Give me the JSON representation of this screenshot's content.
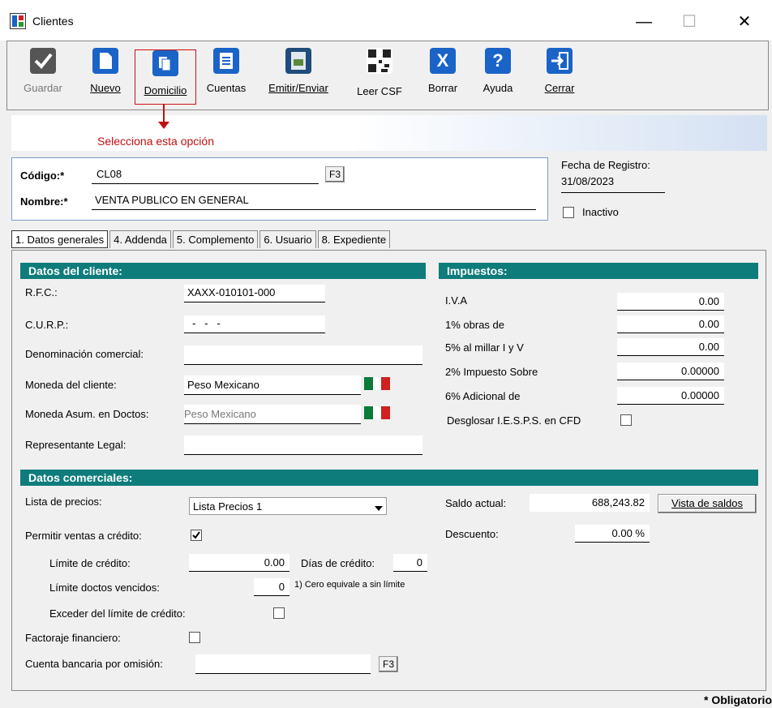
{
  "window": {
    "title": "Clientes",
    "minimize": "—",
    "maximize": "☐",
    "close": "✕"
  },
  "toolbar": {
    "items": [
      {
        "label": "Guardar",
        "icon": "checkmark-icon"
      },
      {
        "label": "Nuevo",
        "icon": "new-document-icon"
      },
      {
        "label": "Domicilio",
        "icon": "address-icon"
      },
      {
        "label": "Cuentas",
        "icon": "list-icon"
      },
      {
        "label": "Emitir/Enviar",
        "icon": "send-document-icon"
      },
      {
        "label": "Leer CSF",
        "icon": "qr-code-icon"
      },
      {
        "label": "Borrar",
        "icon": "delete-icon"
      },
      {
        "label": "Ayuda",
        "icon": "help-icon"
      },
      {
        "label": "Cerrar",
        "icon": "exit-icon"
      }
    ]
  },
  "annotation": "Selecciona esta opción",
  "header": {
    "codigo_label": "Código:*",
    "codigo_value": "CL08",
    "f3": "F3",
    "nombre_label": "Nombre:*",
    "nombre_value": "VENTA PUBLICO EN GENERAL",
    "fecha_label": "Fecha de Registro:",
    "fecha_value": "31/08/2023",
    "inactivo_label": "Inactivo"
  },
  "tabs": [
    "1. Datos generales",
    "4. Addenda",
    "5. Complemento",
    "6. Usuario",
    "8. Expediente"
  ],
  "datos_cliente": {
    "title": "Datos del cliente:",
    "rfc_label": "R.F.C.:",
    "rfc_value": "XAXX-010101-000",
    "curp_label": "C.U.R.P.:",
    "curp_value": "-   -   -",
    "denom_label": "Denominación comercial:",
    "denom_value": "",
    "moneda_label": "Moneda del cliente:",
    "moneda_value": "Peso Mexicano",
    "moneda_asum_label": "Moneda Asum. en Doctos:",
    "moneda_asum_value": "Peso Mexicano",
    "rep_label": "Representante Legal:",
    "rep_value": ""
  },
  "impuestos": {
    "title": "Impuestos:",
    "items": [
      {
        "label": "I.V.A",
        "value": "0.00"
      },
      {
        "label": "1% obras de",
        "value": "0.00"
      },
      {
        "label": "5% al millar I y V",
        "value": "0.00"
      },
      {
        "label": "2% Impuesto Sobre",
        "value": "0.00000"
      },
      {
        "label": "6% Adicional de",
        "value": "0.00000"
      }
    ],
    "desglosar_label": "Desglosar I.E.S.P.S. en CFD"
  },
  "datos_comerciales": {
    "title": "Datos comerciales:",
    "lista_label": "Lista de precios:",
    "lista_value": "Lista Precios 1",
    "saldo_label": "Saldo actual:",
    "saldo_value": "688,243.82",
    "vista_saldos": "Vista de saldos",
    "permitir_label": "Permitir ventas a crédito:",
    "descuento_label": "Descuento:",
    "descuento_value": "0.00 %",
    "limite_label": "Límite de crédito:",
    "limite_value": "0.00",
    "dias_label": "Días de crédito:",
    "dias_value": "0",
    "vencidos_label": "Límite doctos vencidos:",
    "vencidos_value": "0",
    "vencidos_note": "1) Cero equivale a sin límite",
    "exceder_label": "Exceder del límite de crédito:",
    "factoraje_label": "Factoraje financiero:",
    "cuenta_label": "Cuenta bancaria por omisión:",
    "cuenta_value": "",
    "f3": "F3"
  },
  "footer_note": "* Obligatorio"
}
